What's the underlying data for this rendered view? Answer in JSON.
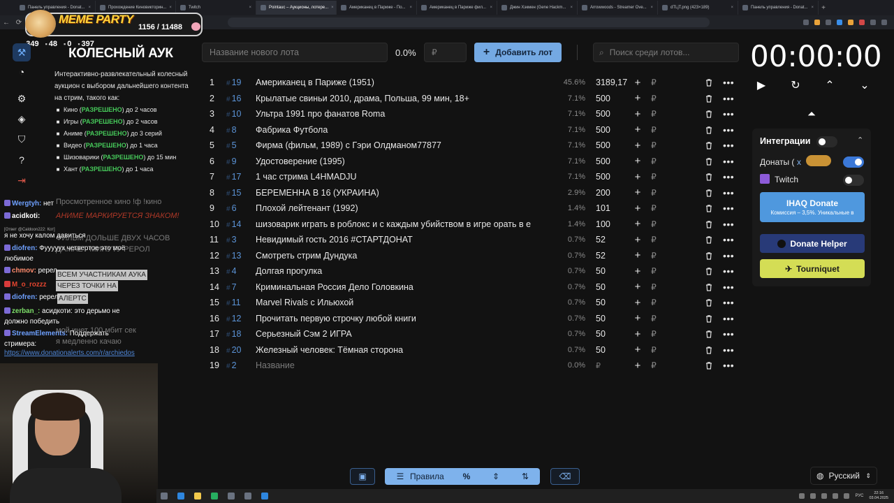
{
  "browser": {
    "tabs": [
      {
        "label": "Панель управления - Donat..."
      },
      {
        "label": "Прохождение Киновикторин..."
      },
      {
        "label": "Twitch"
      },
      {
        "label": "Pointauc – Аукционы, лотере...",
        "active": true
      },
      {
        "label": "Американец в Париже - По..."
      },
      {
        "label": "Американец в Париже фил..."
      },
      {
        "label": "Джин Хэкмен (Gene Hackm..."
      },
      {
        "label": "Arrowwoods - Streamer Ove..."
      },
      {
        "label": "dTLjT.png (423×189)"
      },
      {
        "label": "Панель управления - Donat..."
      }
    ]
  },
  "overlay": {
    "alert_title": "MEME PARTY",
    "alert_progress": "1156 / 11488",
    "stats": [
      "349",
      "48",
      "0",
      "397"
    ]
  },
  "info": {
    "title": "КОЛЕСНЫЙ АУК",
    "description": "Интерактивно-развлекательный колесный аукцион с выбором дальнейшего контента на стрим, такого как:",
    "rules": [
      {
        "pre": "Кино (",
        "ok": "РАЗРЕШЕНО",
        "post": ") до 2 часов",
        "icon": "film-icon"
      },
      {
        "pre": "Игры (",
        "ok": "РАЗРЕШЕНО",
        "post": ") до 2 часов",
        "icon": "gamepad-icon"
      },
      {
        "pre": "Аниме (",
        "ok": "РАЗРЕШЕНО",
        "post": ") до 3 серий",
        "icon": "anime-icon"
      },
      {
        "pre": "Видео (",
        "ok": "РАЗРЕШЕНО",
        "post": ") до 1 часа",
        "icon": "video-icon"
      },
      {
        "pre": "Шизоварики (",
        "ok": "РАЗРЕШЕНО",
        "post": ") до 15 мин",
        "icon": "smile-icon"
      },
      {
        "pre": "Хант (",
        "ok": "РАЗРЕШЕНО",
        "post": ") до 1  часа",
        "icon": "hunt-icon"
      }
    ]
  },
  "chat": {
    "lines": [
      {
        "nick": "Wergtyh:",
        "color": "#6ea0ff",
        "text": " нет"
      },
      {
        "nick": "acidkoti:",
        "color": "#ffffff",
        "text": ""
      },
      {
        "nick": "",
        "color": "#aaa",
        "text": "[Ответ @Caldoon222: Кот]"
      },
      {
        "nick": "",
        "color": "#fff",
        "text": "я не хочу калом давиться"
      },
      {
        "nick": "diofren:",
        "color": "#6ea0ff",
        "text": " Фууууух четвертое это моё"
      },
      {
        "nick": "",
        "color": "#fff",
        "text": "любимое"
      },
      {
        "nick": "chmov:",
        "color": "#ff8c6e",
        "text": " ререл"
      },
      {
        "nick": "M_o_rozzz",
        "color": "#e4452f",
        "text": ""
      },
      {
        "nick": "diofren:",
        "color": "#6ea0ff",
        "text": " ререл"
      },
      {
        "nick": "zerban_:",
        "color": "#7ee06a",
        "text": " асидкоти: это дерьмо не"
      },
      {
        "nick": "",
        "color": "#fff",
        "text": "должно победить"
      },
      {
        "nick": "StreamElements:",
        "color": "#6ea0ff",
        "text": " Поддержать"
      },
      {
        "nick": "",
        "color": "#fff",
        "text": "стримера:"
      },
      {
        "nick": "",
        "color": "#4f86d6",
        "text": "https://www.donationalerts.com/r/archiedos"
      }
    ],
    "overlay_lines": [
      "Просмотренное кино !ф !кино",
      "АНИМЕ МАРКИРУЕТСЯ ЗНАКОМ!",
      "ФИЛЬМ ДОЛЬШЕ ДВУХ ЧАСОВ",
      "ДАМАЕТ МИНУТУ РЕРОЛ",
      "ВСЕМ УЧАСТНИКАМ АУКА",
      "ЧЕРЕЗ ТОЧКИ НА",
      "АЛЕРТС",
      "мой инет 100 мбит сек",
      "я медленно качаю"
    ]
  },
  "toolbar": {
    "new_lot_placeholder": "Название нового лота",
    "percent": "0.0%",
    "currency": "₽",
    "add_label": "Добавить лот",
    "search_placeholder": "Поиск среди лотов..."
  },
  "lots": [
    {
      "n": "1",
      "id": "19",
      "name": "Американец в Париже (1951)",
      "pct": "45.6%",
      "amount": "3189,17"
    },
    {
      "n": "2",
      "id": "16",
      "name": "Крылатые свиньи 2010, драма, Польша, 99 мин, 18+",
      "pct": "7.1%",
      "amount": "500"
    },
    {
      "n": "3",
      "id": "10",
      "name": "Ультра 1991 про фанатов Roma",
      "pct": "7.1%",
      "amount": "500"
    },
    {
      "n": "4",
      "id": "8",
      "name": "Фабрика Футбола",
      "pct": "7.1%",
      "amount": "500"
    },
    {
      "n": "5",
      "id": "5",
      "name": "Фирма (фильм, 1989) с Гэри Олдманом77877",
      "pct": "7.1%",
      "amount": "500"
    },
    {
      "n": "6",
      "id": "9",
      "name": "Удостоверение (1995)",
      "pct": "7.1%",
      "amount": "500"
    },
    {
      "n": "7",
      "id": "17",
      "name": "1 час стрима L4HMADJU",
      "pct": "7.1%",
      "amount": "500"
    },
    {
      "n": "8",
      "id": "15",
      "name": "БЕРЕМЕННА В 16 (УКРАИНА)",
      "pct": "2.9%",
      "amount": "200"
    },
    {
      "n": "9",
      "id": "6",
      "name": "Плохой лейтенант (1992)",
      "pct": "1.4%",
      "amount": "101"
    },
    {
      "n": "10",
      "id": "14",
      "name": "шизоварик играть в роблокс и с каждым убийством в игре орать в е",
      "pct": "1.4%",
      "amount": "100"
    },
    {
      "n": "11",
      "id": "3",
      "name": "Невидимый гость 2016 #СТАРТДОНАТ",
      "pct": "0.7%",
      "amount": "52"
    },
    {
      "n": "12",
      "id": "13",
      "name": "Смотреть стрим Дундука",
      "pct": "0.7%",
      "amount": "52"
    },
    {
      "n": "13",
      "id": "4",
      "name": "Долгая прогулка",
      "pct": "0.7%",
      "amount": "50"
    },
    {
      "n": "14",
      "id": "7",
      "name": "Криминальная Россия Дело Головкина",
      "pct": "0.7%",
      "amount": "50"
    },
    {
      "n": "15",
      "id": "11",
      "name": "Marvel Rivals с Ильюхой",
      "pct": "0.7%",
      "amount": "50"
    },
    {
      "n": "16",
      "id": "12",
      "name": "Прочитать первую строчку любой книги",
      "pct": "0.7%",
      "amount": "50"
    },
    {
      "n": "17",
      "id": "18",
      "name": "Серьезный Сэм 2 ИГРА",
      "pct": "0.7%",
      "amount": "50"
    },
    {
      "n": "18",
      "id": "20",
      "name": "Железный человек: Тёмная сторона",
      "pct": "0.7%",
      "amount": "50"
    },
    {
      "n": "19",
      "id": "2",
      "name": "Название",
      "pct": "0.0%",
      "amount": "",
      "placeholder": true
    }
  ],
  "timer": {
    "display": "00:00:00"
  },
  "integrations": {
    "title": "Интеграции",
    "donations_label": "Донаты (",
    "donations_x": "x",
    "twitch_label": "Twitch",
    "ihaq_title": "IHAQ Donate",
    "ihaq_sub": "Комиссия – 3,5%. Уникальные в",
    "donate_helper": "Donate Helper",
    "tourniquet": "Tourniquet"
  },
  "bottom": {
    "rules_label": "Правила",
    "language": "Русский"
  },
  "taskbar": {
    "lang": "РУС",
    "time": "22:16",
    "date": "03.04.2025"
  },
  "colors": {
    "accent": "#74a9e3",
    "allowed": "#46c95a",
    "id": "#5b93d6"
  }
}
